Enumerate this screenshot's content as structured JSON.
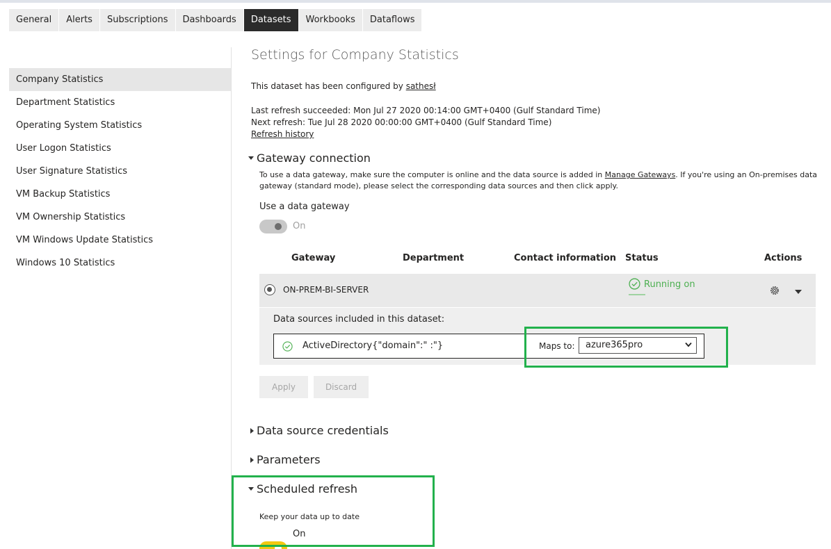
{
  "tabs": [
    {
      "label": "General",
      "active": false
    },
    {
      "label": "Alerts",
      "active": false
    },
    {
      "label": "Subscriptions",
      "active": false
    },
    {
      "label": "Dashboards",
      "active": false
    },
    {
      "label": "Datasets",
      "active": true
    },
    {
      "label": "Workbooks",
      "active": false
    },
    {
      "label": "Dataflows",
      "active": false
    }
  ],
  "sidebar": {
    "items": [
      {
        "label": "Company Statistics",
        "active": true
      },
      {
        "label": "Department Statistics"
      },
      {
        "label": "Operating System Statistics"
      },
      {
        "label": "User Logon Statistics"
      },
      {
        "label": "User Signature Statistics"
      },
      {
        "label": "VM Backup Statistics"
      },
      {
        "label": "VM Ownership Statistics"
      },
      {
        "label": "VM Windows Update Statistics"
      },
      {
        "label": "Windows 10 Statistics"
      }
    ]
  },
  "main": {
    "title": "Settings for Company Statistics",
    "configured_prefix": "This dataset has been configured by ",
    "configured_user": "sathesł",
    "last_refresh": "Last refresh succeeded: Mon Jul 27 2020 00:14:00 GMT+0400 (Gulf Standard Time)",
    "next_refresh": "Next refresh: Tue Jul 28 2020 00:00:00 GMT+0400 (Gulf Standard Time)",
    "refresh_history": "Refresh history"
  },
  "gateway": {
    "heading": "Gateway connection",
    "desc_part1": "To use a data gateway, make sure the computer is online and the data source is added in ",
    "desc_link": "Manage Gateways",
    "desc_part2": ". If you're using an On-premises data",
    "desc_line2": "gateway (standard mode), please select the corresponding data sources and then click apply.",
    "use_label": "Use a data gateway",
    "toggle_label": "On",
    "columns": {
      "gateway": "Gateway",
      "department": "Department",
      "contact": "Contact information",
      "status": "Status",
      "actions": "Actions"
    },
    "row": {
      "name": "ON-PREM-BI-SERVER",
      "status": "Running on"
    },
    "ds_heading": "Data sources included in this dataset:",
    "ds_name": "ActiveDirectory{\"domain\":\"          :\"}",
    "maps_label": "Maps to:",
    "maps_value": "azure365pro",
    "apply": "Apply",
    "discard": "Discard"
  },
  "sections": {
    "credentials": "Data source credentials",
    "parameters": "Parameters",
    "scheduled": "Scheduled refresh",
    "keep_up": "Keep your data up to date",
    "scheduled_toggle": "On"
  },
  "colors": {
    "highlight": "#22b14c",
    "status_ok": "#4caf50",
    "toggle_on": "#f2c811",
    "tab_active": "#2b2b2b"
  }
}
